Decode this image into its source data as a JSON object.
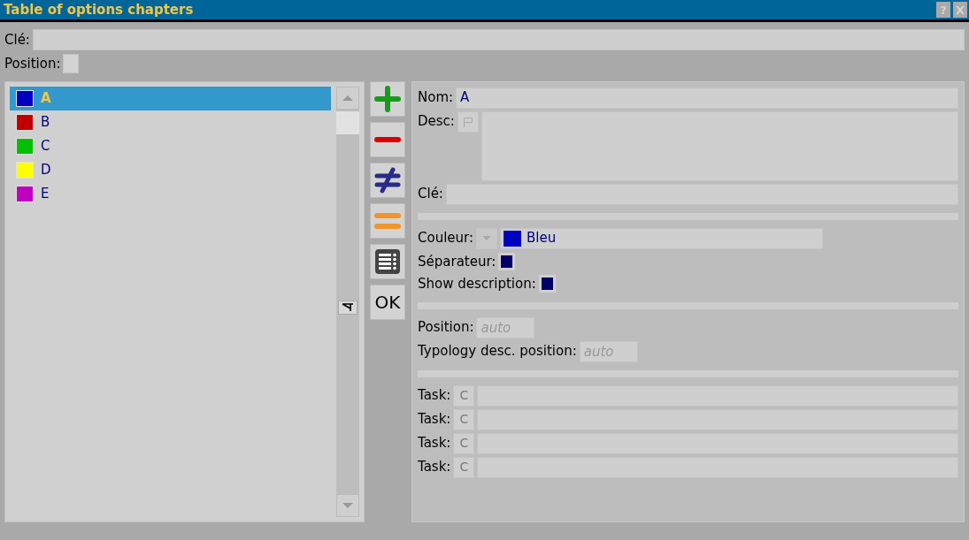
{
  "window": {
    "title": "Table of options chapters",
    "buttons": [
      "?",
      "X"
    ]
  },
  "header": {
    "key_label": "Clé:",
    "position_label": "Position:"
  },
  "chapters": [
    {
      "label": "A",
      "color": "#0000c0",
      "selected": true
    },
    {
      "label": "B",
      "color": "#c00000",
      "selected": false
    },
    {
      "label": "C",
      "color": "#00c000",
      "selected": false
    },
    {
      "label": "D",
      "color": "#ffff00",
      "selected": false
    },
    {
      "label": "E",
      "color": "#c000c0",
      "selected": false
    }
  ],
  "toolbar": [
    {
      "kind": "add"
    },
    {
      "kind": "remove"
    },
    {
      "kind": "different"
    },
    {
      "kind": "equal"
    },
    {
      "kind": "list"
    },
    {
      "kind": "text",
      "label": "OK"
    }
  ],
  "detail": {
    "name_label": "Nom:",
    "name_value": "A",
    "desc_label": "Desc:",
    "key_label": "Clé:",
    "color_label": "Couleur:",
    "color_value": "Bleu",
    "color": "#0000c0",
    "separator_label": "Séparateur:",
    "separator_checked": true,
    "show_desc_label": "Show description:",
    "show_desc_checked": true,
    "position_label": "Position:",
    "position_placeholder": "auto",
    "typology_label": "Typology desc. position:",
    "typology_placeholder": "auto",
    "tasks": [
      {
        "label": "Task:",
        "button": "C"
      },
      {
        "label": "Task:",
        "button": "C"
      },
      {
        "label": "Task:",
        "button": "C"
      },
      {
        "label": "Task:",
        "button": "C"
      }
    ]
  }
}
